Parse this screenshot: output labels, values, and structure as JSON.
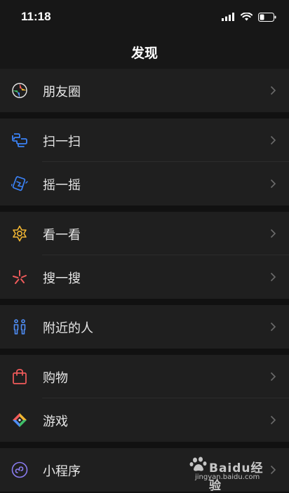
{
  "status_bar": {
    "time": "11:18"
  },
  "header": {
    "title": "发现"
  },
  "items": [
    {
      "label": "朋友圈",
      "icon": "moments-icon"
    },
    {
      "label": "扫一扫",
      "icon": "scan-icon"
    },
    {
      "label": "摇一摇",
      "icon": "shake-icon"
    },
    {
      "label": "看一看",
      "icon": "top-stories-icon"
    },
    {
      "label": "搜一搜",
      "icon": "search-icon"
    },
    {
      "label": "附近的人",
      "icon": "people-nearby-icon"
    },
    {
      "label": "购物",
      "icon": "shopping-bag-icon"
    },
    {
      "label": "游戏",
      "icon": "games-icon"
    },
    {
      "label": "小程序",
      "icon": "mini-programs-icon"
    }
  ],
  "watermark": {
    "brand": "Baidu经验",
    "url": "jingyan.baidu.com"
  },
  "colors": {
    "background": "#111111",
    "row": "#1f1f1f",
    "text": "#e6e6e6",
    "scan_blue": "#3b82f6",
    "topstories_yellow": "#f2b632",
    "search_red": "#f05b5b",
    "nearby_blue": "#4f8ef7",
    "shopping_red": "#f25b5b",
    "miniprogram_purple": "#8a7cf0"
  }
}
